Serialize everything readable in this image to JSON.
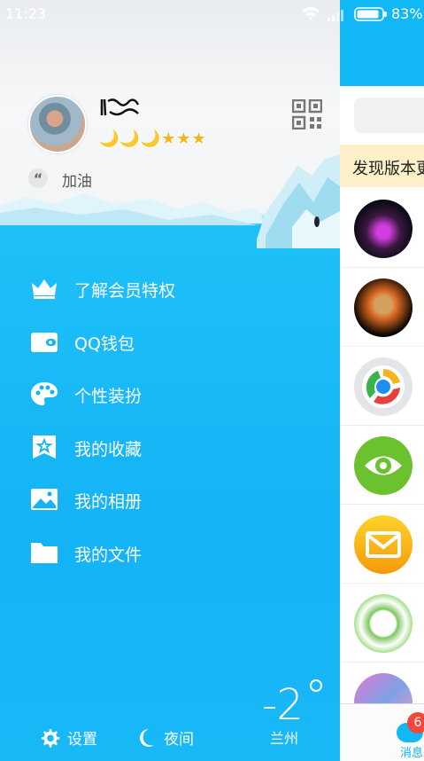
{
  "status_bar": {
    "time": "11:23",
    "battery": "83%"
  },
  "profile": {
    "level_stars": "🌙🌙🌙★★★",
    "signature": "加油"
  },
  "menu": [
    {
      "label": "了解会员特权",
      "icon": "crown-icon"
    },
    {
      "label": "QQ钱包",
      "icon": "wallet-icon"
    },
    {
      "label": "个性装扮",
      "icon": "palette-icon"
    },
    {
      "label": "我的收藏",
      "icon": "favorite-icon"
    },
    {
      "label": "我的相册",
      "icon": "album-icon"
    },
    {
      "label": "我的文件",
      "icon": "folder-icon"
    }
  ],
  "bottom": {
    "settings": "设置",
    "night": "夜间"
  },
  "weather": {
    "temperature": "-2",
    "city": "兰州"
  },
  "right_panel": {
    "banner": "发现版本更新",
    "msg_badge": "6",
    "msg_label": "消息"
  },
  "colors": {
    "accent": "#12b7f5",
    "badge": "#f2473a",
    "banner_bg": "#fdf0c8"
  }
}
